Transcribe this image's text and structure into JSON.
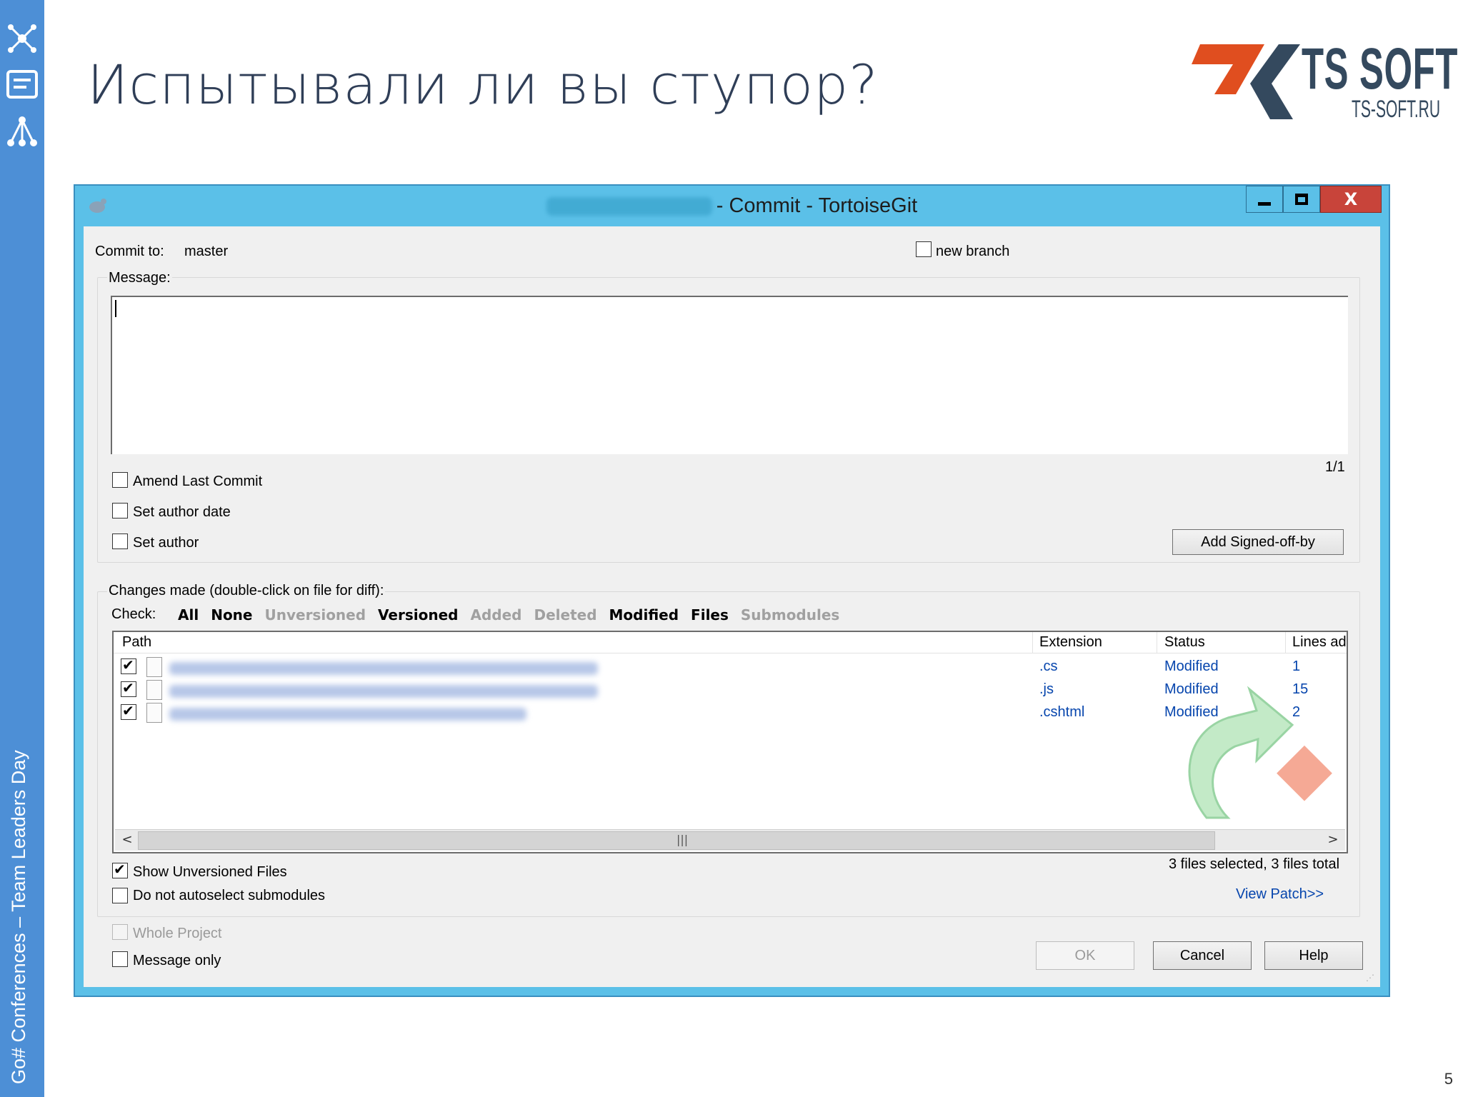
{
  "slide": {
    "title": "Испытывали ли вы ступор?",
    "side_caption": "Go# Conferences – Team Leaders Day",
    "page_number": "5",
    "logo": {
      "text": "TS SOFT",
      "sub": "TS-SOFT.RU"
    },
    "accent_color": "#4d8fd6"
  },
  "window": {
    "title_suffix": "- Commit - TortoiseGit",
    "close_glyph": "X",
    "titlebar_color": "#5bc0e8"
  },
  "commit": {
    "commit_to_label": "Commit to:",
    "branch": "master",
    "new_branch_label": "new branch",
    "message_label": "Message:",
    "message_value": "",
    "position": "1/1",
    "amend_label": "Amend Last Commit",
    "set_author_date_label": "Set author date",
    "set_author_label": "Set author",
    "signed_off_button": "Add Signed-off-by"
  },
  "changes": {
    "header": "Changes made (double-click on file for diff):",
    "check_label": "Check:",
    "filters": [
      {
        "label": "All",
        "active": true
      },
      {
        "label": "None",
        "active": true
      },
      {
        "label": "Unversioned",
        "active": false
      },
      {
        "label": "Versioned",
        "active": true
      },
      {
        "label": "Added",
        "active": false
      },
      {
        "label": "Deleted",
        "active": false
      },
      {
        "label": "Modified",
        "active": true
      },
      {
        "label": "Files",
        "active": true
      },
      {
        "label": "Submodules",
        "active": false
      }
    ],
    "columns": [
      "Path",
      "Extension",
      "Status",
      "Lines ad"
    ],
    "rows": [
      {
        "extension": ".cs",
        "status": "Modified",
        "lines": "1"
      },
      {
        "extension": ".js",
        "status": "Modified",
        "lines": "15"
      },
      {
        "extension": ".cshtml",
        "status": "Modified",
        "lines": "2"
      }
    ],
    "summary": "3 files selected, 3 files total",
    "view_patch": "View Patch>>",
    "show_unversioned_label": "Show Unversioned Files",
    "no_autoselect_label": "Do not autoselect submodules"
  },
  "footer": {
    "whole_project_label": "Whole Project",
    "message_only_label": "Message only",
    "ok_button": "OK",
    "cancel_button": "Cancel",
    "help_button": "Help"
  }
}
